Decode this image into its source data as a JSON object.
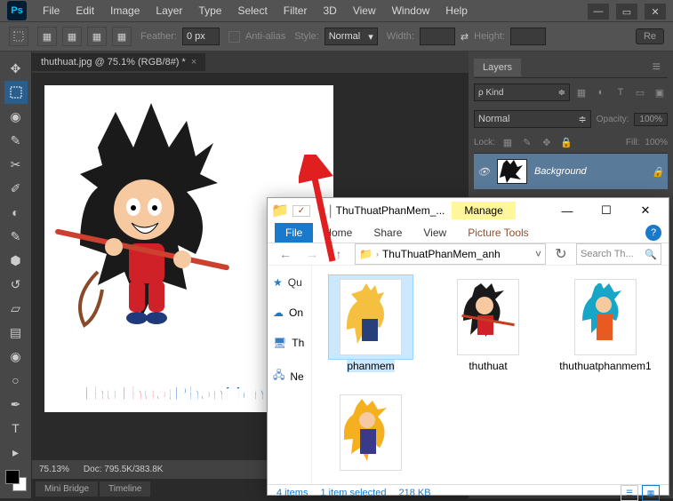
{
  "ps": {
    "menu": [
      "File",
      "Edit",
      "Image",
      "Layer",
      "Type",
      "Select",
      "Filter",
      "3D",
      "View",
      "Window",
      "Help"
    ],
    "options": {
      "feather_label": "Feather:",
      "feather_value": "0 px",
      "anti_alias": "Anti-alias",
      "style_label": "Style:",
      "style_value": "Normal",
      "width_label": "Width:",
      "link_icon": "⇄",
      "height_label": "Height:",
      "refine_btn": "Re"
    },
    "tab": {
      "title": "thuthuat.jpg @ 75.1% (RGB/8#) *"
    },
    "status": {
      "zoom": "75.13%",
      "doc": "Doc: 795.5K/383.8K"
    },
    "bottom_tabs": [
      "Mini Bridge",
      "Timeline"
    ],
    "panels": {
      "layers_tab": "Layers",
      "kind_label": "Kind",
      "blend_mode": "Normal",
      "opacity_label": "Opacity:",
      "opacity_value": "100%",
      "lock_label": "Lock:",
      "fill_label": "Fill:",
      "fill_value": "100%",
      "layer_name": "Background"
    }
  },
  "explorer": {
    "title": "ThuThuatPhanMem_...",
    "manage_tab": "Manage",
    "ribbon": {
      "file": "File",
      "home": "Home",
      "share": "Share",
      "view": "View",
      "ctx": "Picture Tools"
    },
    "address": {
      "folder": "ThuThuatPhanMem_anh"
    },
    "search_placeholder": "Search Th...",
    "nav": {
      "quick": "Quick access",
      "onedrive": "OneDrive",
      "thispc": "This PC",
      "network": "Network"
    },
    "files": [
      {
        "name": "phanmem",
        "selected": true
      },
      {
        "name": "thuthuat",
        "selected": false
      },
      {
        "name": "thuthuatphanmem1",
        "selected": false
      },
      {
        "name": "",
        "selected": false
      }
    ],
    "status": {
      "count": "4 items",
      "selection": "1 item selected",
      "size": "218 KB"
    }
  },
  "watermark": {
    "part1": "ThuThuat",
    "part2": "PhanMem",
    "part3": ".vn"
  }
}
